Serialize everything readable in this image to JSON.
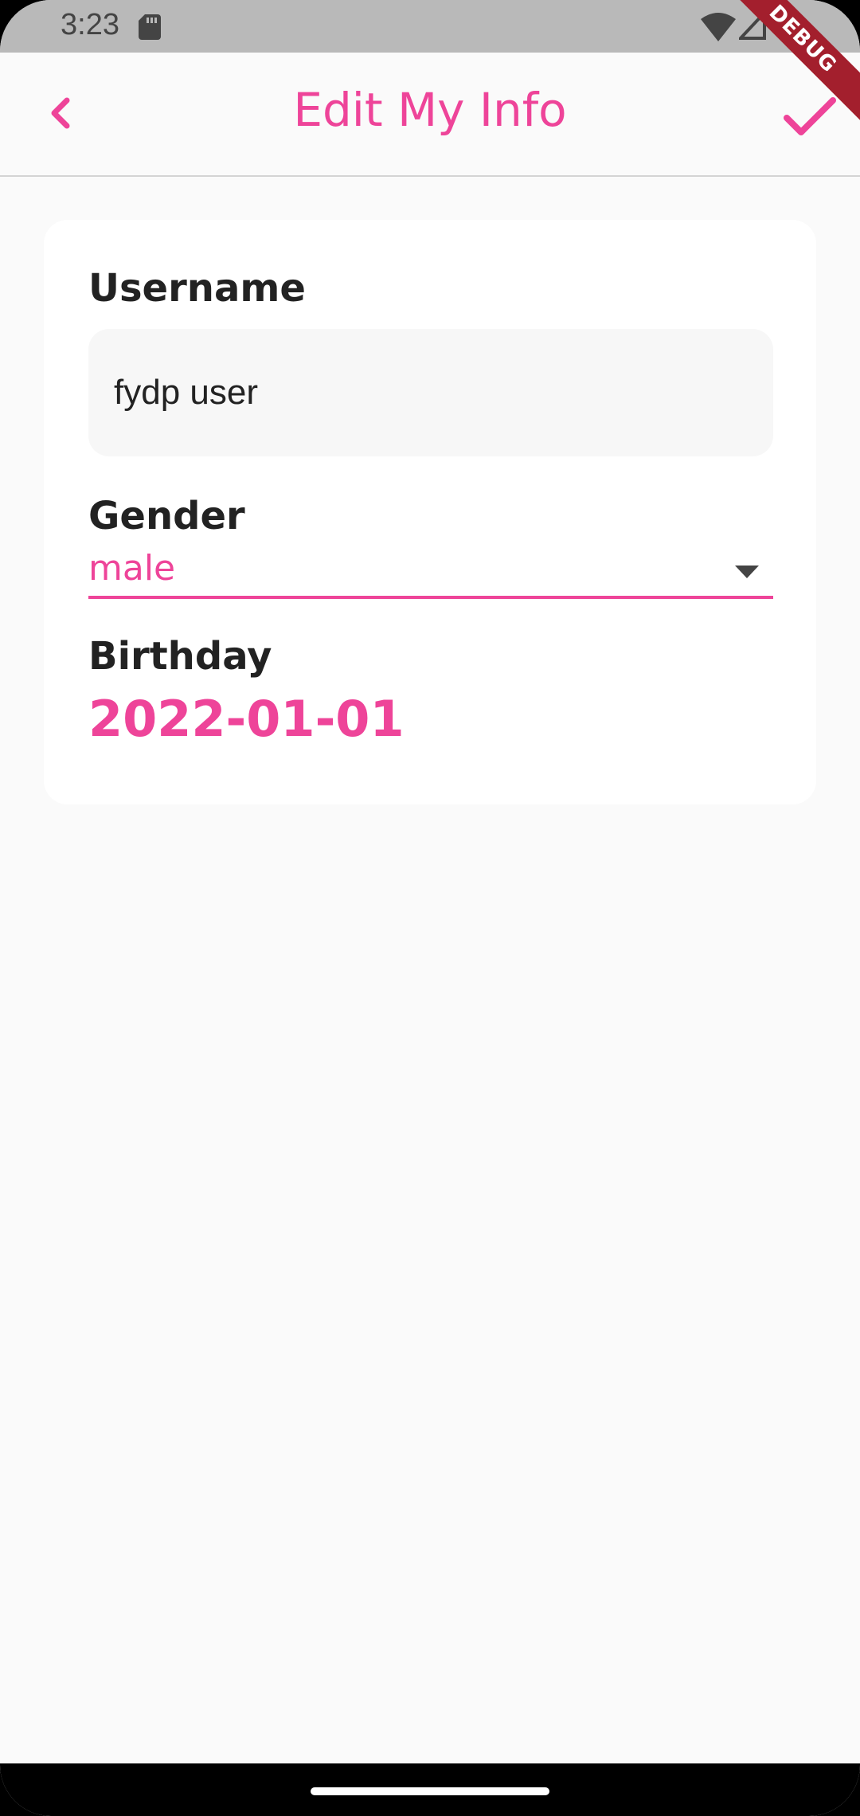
{
  "status_bar": {
    "time": "3:23",
    "icons": [
      "sd-card-icon",
      "wifi-icon",
      "signal-icon"
    ]
  },
  "debug_banner": {
    "label": "DEBUG"
  },
  "app_bar": {
    "title": "Edit My Info",
    "back_icon": "chevron-left-icon",
    "confirm_icon": "check-icon"
  },
  "form": {
    "username": {
      "label": "Username",
      "value": "fydp user"
    },
    "gender": {
      "label": "Gender",
      "value": "male"
    },
    "birthday": {
      "label": "Birthday",
      "value": "2022-01-01"
    }
  },
  "colors": {
    "accent": "#ee4499",
    "background": "#fafafa",
    "card": "#ffffff",
    "status_bar": "#b9b9b9",
    "debug_banner": "#a31f2d"
  }
}
